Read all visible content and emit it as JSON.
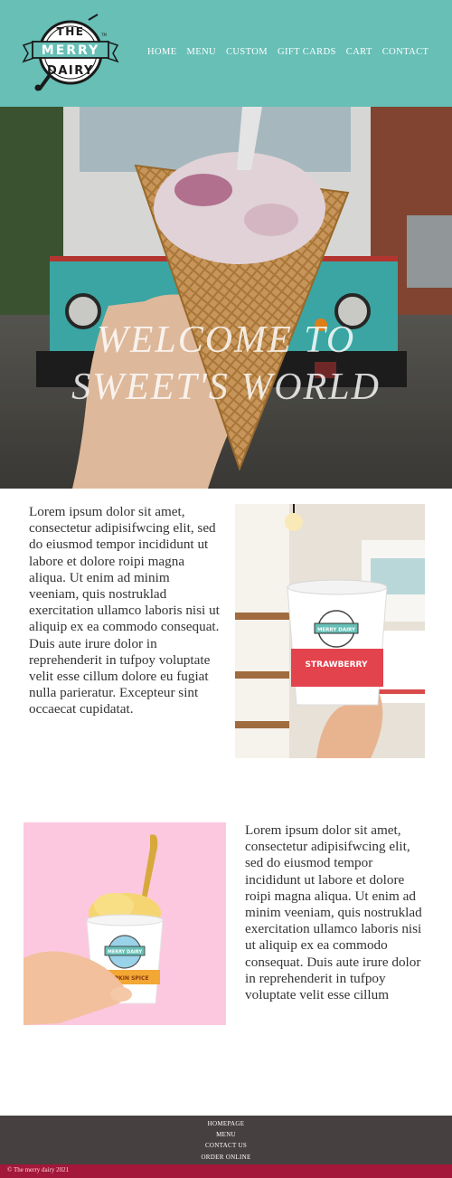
{
  "header": {
    "logo": {
      "line1": "THE",
      "line2": "MERRY",
      "line3": "DAIRY",
      "mark": "TM"
    },
    "nav": [
      "HOME",
      "MENU",
      "CUSTOM",
      "GIFT CARDS",
      "CART",
      "CONTACT"
    ]
  },
  "hero": {
    "title_line1": "WELCOME TO",
    "title_line2": "SWEET'S WORLD"
  },
  "section1": {
    "text": "Lorem ipsum dolor sit amet, consectetur adipisifwcing elit, sed do eiusmod tempor incididunt ut labore et dolore roipi magna aliqua. Ut enim ad minim veeniam, quis nostruklad exercitation ullamco laboris nisi ut aliquip ex ea commodo consequat. Duis aute irure dolor in reprehenderit in tufpoy voluptate velit esse cillum dolore eu fugiat nulla parieratur. Excepteur sint occaecat cupidatat.",
    "cup_label": "STRAWBERRY",
    "cup_logo": "MERRY DAIRY"
  },
  "section2": {
    "text": "Lorem ipsum dolor sit amet, consectetur adipisifwcing elit, sed do eiusmod tempor incididunt ut labore et dolore roipi magna aliqua. Ut enim ad minim veeniam, quis nostruklad exercitation ullamco laboris nisi ut aliquip ex ea commodo consequat. Duis aute irure dolor in reprehenderit in tufpoy voluptate velit esse cillum",
    "cup_label": "PUMPKIN SPICE",
    "cup_logo": "MERRY DAIRY"
  },
  "footer": {
    "links": [
      "HOMEPAGE",
      "MENU",
      "CONTACT US",
      "ORDER ONLINE"
    ],
    "copyright": "© The merry dairy 2021"
  },
  "colors": {
    "header": "#67bfb6",
    "footer": "#474040",
    "copyright_bar": "#a3173a"
  }
}
